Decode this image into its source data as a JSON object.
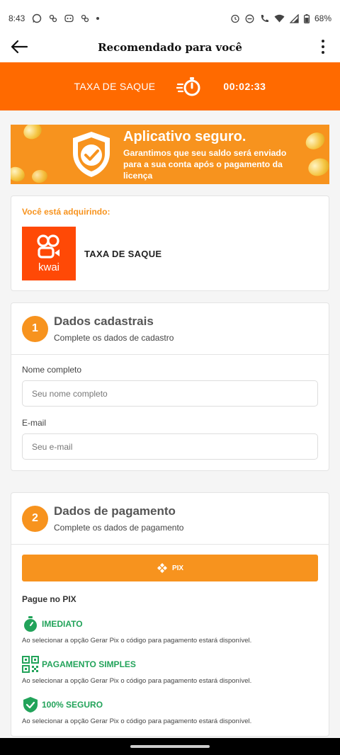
{
  "status": {
    "time": "8:43",
    "battery": "68%",
    "left_icons": [
      "whatsapp-icon",
      "app-icon",
      "notification-icon",
      "app-icon",
      "dot-icon"
    ],
    "right_icons": [
      "alarm-icon",
      "dnd-icon",
      "call-icon",
      "wifi-icon",
      "signal-icon",
      "battery-icon"
    ]
  },
  "app_bar": {
    "title": "Recomendado para você"
  },
  "timer": {
    "label": "TAXA DE SAQUE",
    "value": "00:02:33"
  },
  "banner": {
    "title": "Aplicativo seguro.",
    "description": "Garantimos que seu saldo será enviado para a sua conta após o pagamento da licença"
  },
  "purchase": {
    "label": "Você está adquirindo:",
    "logo_text": "kwai",
    "product": "TAXA DE SAQUE"
  },
  "step1": {
    "number": "1",
    "title": "Dados cadastrais",
    "subtitle": "Complete os dados de cadastro",
    "name_label": "Nome completo",
    "name_placeholder": "Seu nome completo",
    "name_value": "",
    "email_label": "E-mail",
    "email_placeholder": "Seu e-mail",
    "email_value": ""
  },
  "step2": {
    "number": "2",
    "title": "Dados de pagamento",
    "subtitle": "Complete os dados de pagamento",
    "pix_button": "PIX",
    "pay_title": "Pague no PIX",
    "features": [
      {
        "icon": "stopwatch-icon",
        "title": "IMEDIATO",
        "desc": "Ao selecionar a opção Gerar Pix o código para pagamento estará disponível."
      },
      {
        "icon": "qr-code-icon",
        "title": "PAGAMENTO SIMPLES",
        "desc": "Ao selecionar a opção Gerar Pix o código para pagamento estará disponível."
      },
      {
        "icon": "shield-check-icon",
        "title": "100% SEGURO",
        "desc": "Ao selecionar a opção Gerar Pix o código para pagamento estará disponível."
      }
    ]
  },
  "colors": {
    "accent": "#ff6a00",
    "orange": "#f7931e",
    "kwai": "#ff4906",
    "green": "#22a35a"
  }
}
